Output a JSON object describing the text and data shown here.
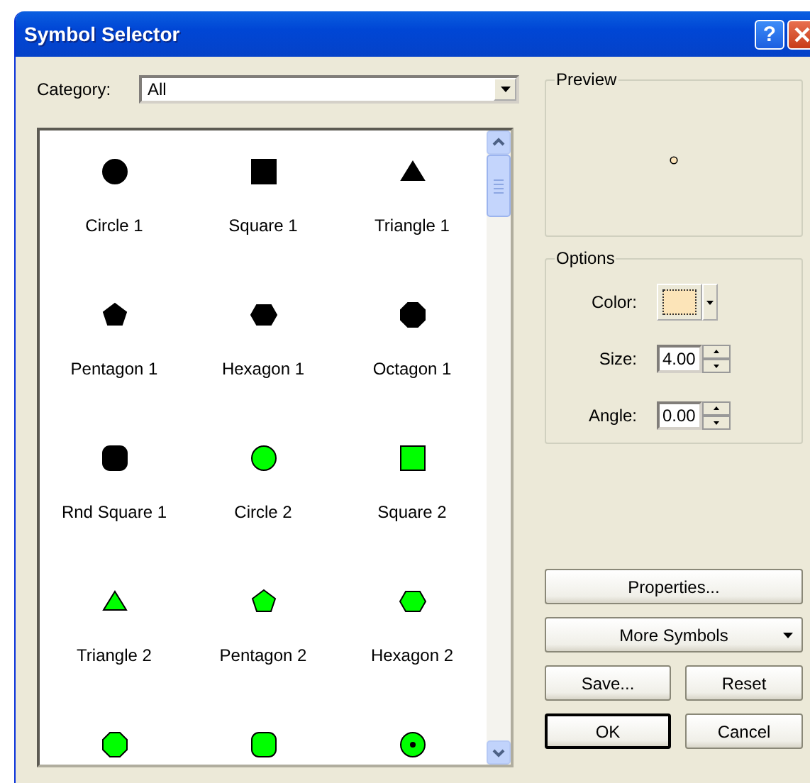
{
  "window": {
    "title": "Symbol Selector",
    "help_button": "?"
  },
  "category": {
    "label": "Category:",
    "value": "All"
  },
  "symbols": [
    {
      "kind": "circle",
      "color": "#000000",
      "label": "Circle 1"
    },
    {
      "kind": "square",
      "color": "#000000",
      "label": "Square 1"
    },
    {
      "kind": "triangle",
      "color": "#000000",
      "label": "Triangle 1"
    },
    {
      "kind": "pentagon",
      "color": "#000000",
      "label": "Pentagon 1"
    },
    {
      "kind": "hexagon",
      "color": "#000000",
      "label": "Hexagon 1"
    },
    {
      "kind": "octagon",
      "color": "#000000",
      "label": "Octagon 1"
    },
    {
      "kind": "rnd-square",
      "color": "#000000",
      "label": "Rnd Square 1"
    },
    {
      "kind": "circle",
      "color": "#00ff00",
      "label": "Circle 2"
    },
    {
      "kind": "square",
      "color": "#00ff00",
      "label": "Square 2"
    },
    {
      "kind": "triangle",
      "color": "#00ff00",
      "label": "Triangle 2"
    },
    {
      "kind": "pentagon",
      "color": "#00ff00",
      "label": "Pentagon 2"
    },
    {
      "kind": "hexagon",
      "color": "#00ff00",
      "label": "Hexagon 2"
    },
    {
      "kind": "octagon",
      "color": "#00ff00"
    },
    {
      "kind": "rnd-square",
      "color": "#00ff00"
    },
    {
      "kind": "circle-dot",
      "color": "#00ff00"
    }
  ],
  "preview": {
    "title": "Preview"
  },
  "options": {
    "title": "Options",
    "color_label": "Color:",
    "color": "#fce4b8",
    "size_label": "Size:",
    "size": "4.00",
    "angle_label": "Angle:",
    "angle": "0.00"
  },
  "buttons": [
    {
      "kind": "wide",
      "label": "Properties...",
      "default": false
    },
    {
      "kind": "dropdown",
      "label": "More Symbols",
      "default": false
    },
    {
      "kind": "small",
      "label": "Save...",
      "default": false
    },
    {
      "kind": "small",
      "label": "Reset",
      "default": false
    },
    {
      "kind": "small",
      "label": "OK",
      "default": true
    },
    {
      "kind": "small",
      "label": "Cancel",
      "default": false
    }
  ]
}
